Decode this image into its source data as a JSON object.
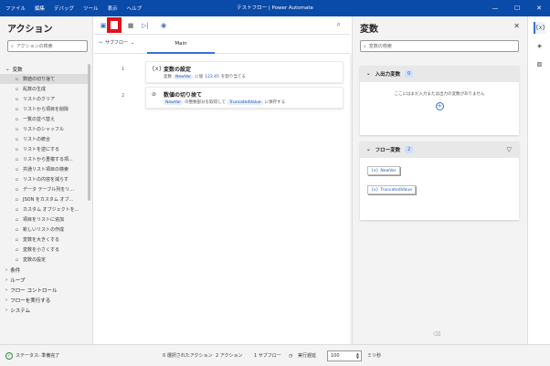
{
  "window": {
    "title": "テストフロー | Power Automate",
    "menu": [
      "ファイル",
      "編集",
      "デバッグ",
      "ツール",
      "表示",
      "ヘルプ"
    ]
  },
  "actions_panel": {
    "title": "アクション",
    "search_placeholder": "アクションの検索",
    "category_variables": "変数",
    "items": [
      {
        "label": "数値の切り捨て",
        "icon": "calc-icon"
      },
      {
        "label": "乱数の生成",
        "icon": "dice-icon"
      },
      {
        "label": "リストのクリア",
        "icon": "list-clear-icon"
      },
      {
        "label": "リストから項目を削除",
        "icon": "list-remove-icon"
      },
      {
        "label": "一覧の並べ替え",
        "icon": "sort-icon"
      },
      {
        "label": "リストのシャッフル",
        "icon": "shuffle-icon"
      },
      {
        "label": "リストの統合",
        "icon": "merge-icon"
      },
      {
        "label": "リストを逆にする",
        "icon": "reverse-icon"
      },
      {
        "label": "リストから重複する項...",
        "icon": "dedupe-icon"
      },
      {
        "label": "共通リスト項目の検索",
        "icon": "common-icon"
      },
      {
        "label": "リストの内容を減らす",
        "icon": "subtract-icon"
      },
      {
        "label": "データ テーブル列をリ...",
        "icon": "table-icon"
      },
      {
        "label": "JSON をカスタム オブ...",
        "icon": "json-icon"
      },
      {
        "label": "カスタム オブジェクトを...",
        "icon": "object-icon"
      },
      {
        "label": "項目をリストに追加",
        "icon": "add-list-icon"
      },
      {
        "label": "新しいリストの作成",
        "icon": "new-list-icon"
      },
      {
        "label": "変数を大きくする",
        "icon": "increase-icon"
      },
      {
        "label": "変数を小さくする",
        "icon": "decrease-icon"
      },
      {
        "label": "変数の設定",
        "icon": "variable-icon"
      }
    ],
    "categories_after": [
      "条件",
      "ループ",
      "フロー コントロール",
      "フローを実行する",
      "システム"
    ]
  },
  "toolbar": {
    "subflow_label": "サブフロー",
    "tab_main": "Main"
  },
  "steps": [
    {
      "num": "1",
      "title": "変数の設定",
      "desc_prefix": "変数",
      "var": "NewVar",
      "desc_mid": "に値",
      "value": "123.45",
      "desc_suffix": "を割り当てる"
    },
    {
      "num": "2",
      "title": "数値の切り捨て",
      "var": "NewVar",
      "desc_mid": "の整数部分を取得して",
      "value": "TruncatedValue",
      "desc_suffix": "に保存する"
    }
  ],
  "vars_panel": {
    "title": "変数",
    "search_placeholder": "変数の検索",
    "io_section": {
      "label": "入出力変数",
      "count": "0",
      "empty_text": "ここにはまだ入力または出力の変数がありません"
    },
    "flow_section": {
      "label": "フロー変数",
      "count": "2",
      "vars": [
        "NewVar",
        "TruncatedValue"
      ]
    }
  },
  "statusbar": {
    "status": "ステータス: 準備完了",
    "selected_actions": "0 選択されたアクション",
    "action_count": "2 アクション",
    "subflow_count": "1 サブフロー",
    "run_delay_label": "実行遅延",
    "run_delay_value": "100",
    "unit": "ミリ秒"
  },
  "colors": {
    "titlebar": "#0a4aa8",
    "accent": "#3a6fd1",
    "run_highlight": "#e1101a"
  }
}
